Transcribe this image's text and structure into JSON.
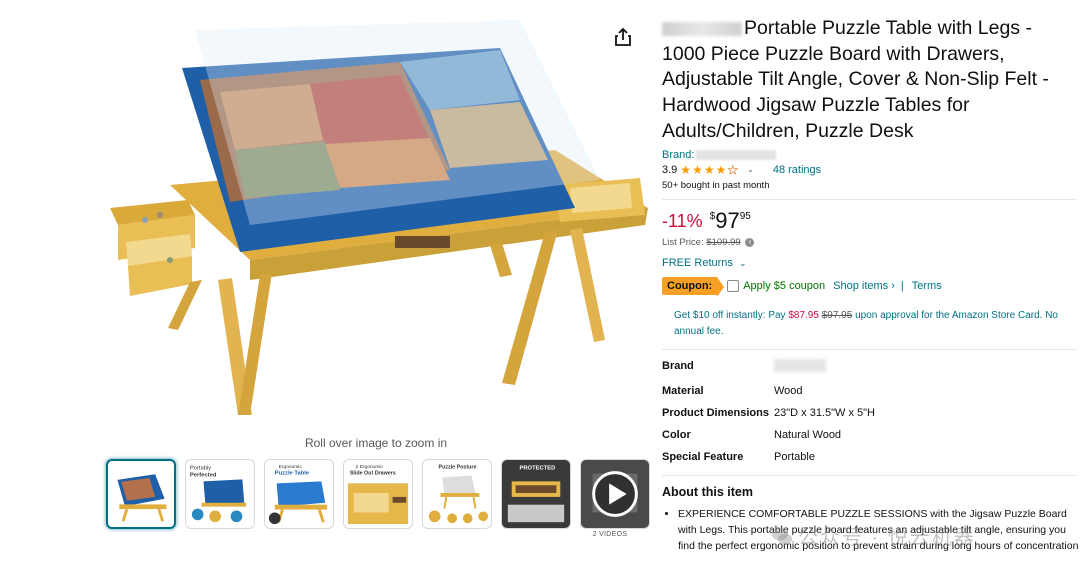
{
  "gallery": {
    "zoom_hint": "Roll over image to zoom in",
    "videos_label": "2 VIDEOS",
    "thumbnails": [
      {
        "name": "thumb-main-table",
        "caption": ""
      },
      {
        "name": "thumb-portably-perfected",
        "caption": "Portably Perfected"
      },
      {
        "name": "thumb-portable-puzzle-table",
        "caption": "Portable Puzzle Table"
      },
      {
        "name": "thumb-slide-out-drawers",
        "caption": "Slide Out Drawers"
      },
      {
        "name": "thumb-puzzle-posture",
        "caption": "Puzzle Posture"
      },
      {
        "name": "thumb-protected",
        "caption": "PROTECTED"
      },
      {
        "name": "thumb-video",
        "caption": ""
      }
    ],
    "thumb_captions": {
      "t2_line1": "Portably",
      "t2_line2": "Perfected",
      "t3_line1": "Ergonomic",
      "t3_line2": "Puzzle Table",
      "t4_line1": "2 Ergonomic",
      "t4_line2": "Slide Out Drawers",
      "t5_line1": "Puzzle Posture",
      "t6_line1": "PROTECTED"
    }
  },
  "product": {
    "title": "Portable Puzzle Table with Legs - 1000 Piece Puzzle Board with Drawers, Adjustable Tilt Angle, Cover & Non-Slip Felt - Hardwood Jigsaw Puzzle Tables for Adults/Children, Puzzle Desk",
    "brand_label": "Brand:",
    "rating_value": "3.9",
    "rating_stars": 3.9,
    "ratings_count": "48 ratings",
    "bought_text": "50+ bought in past month",
    "discount": "-11%",
    "price_symbol": "$",
    "price_whole": "97",
    "price_fraction": "95",
    "list_price_label": "List Price:",
    "list_price": "$109.99",
    "free_returns": "FREE Returns",
    "coupon_label": "Coupon:",
    "coupon_text": "Apply $5 coupon",
    "shop_items": "Shop items ›",
    "separator": "|",
    "terms": "Terms",
    "card_offer_prefix": "Get $10 off instantly: Pay",
    "card_offer_new_price": "$87.95",
    "card_offer_old_price": "$97.95",
    "card_offer_suffix": "upon approval for the Amazon Store Card. No annual fee."
  },
  "specs": [
    {
      "key": "Brand",
      "value": ""
    },
    {
      "key": "Material",
      "value": "Wood"
    },
    {
      "key": "Product Dimensions",
      "value": "23\"D x 31.5\"W x 5\"H"
    },
    {
      "key": "Color",
      "value": "Natural Wood"
    },
    {
      "key": "Special Feature",
      "value": "Portable"
    }
  ],
  "about": {
    "title": "About this item",
    "bullets": [
      "EXPERIENCE COMFORTABLE PUZZLE SESSIONS with the Jigsaw Puzzle Board with Legs. This portable puzzle board features an adjustable tilt angle, ensuring you find the perfect ergonomic position to prevent strain during long hours of concentration"
    ]
  },
  "watermark": "公众号 · 悦云机器",
  "colors": {
    "link": "#007185",
    "deal_red": "#cc0c39",
    "star": "#ff9900",
    "coupon_badge": "#f7a025",
    "coupon_green": "#007600",
    "puzzle_blue": "#1f5fa8",
    "wood": "#e6b84a"
  }
}
